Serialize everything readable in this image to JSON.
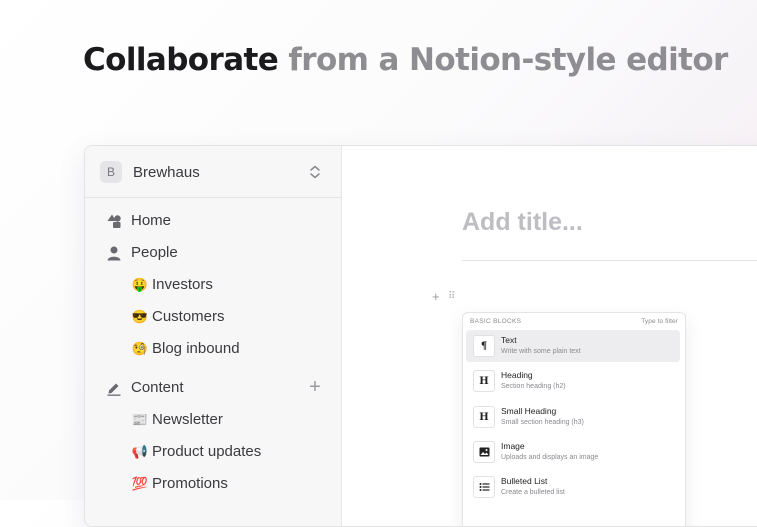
{
  "headline": {
    "strong": "Collaborate",
    "muted": "from a Notion-style editor"
  },
  "workspace": {
    "initial": "B",
    "name": "Brewhaus"
  },
  "sidebar": {
    "items": [
      {
        "label": "Home",
        "icon": "home-icon",
        "level": 0
      },
      {
        "label": "People",
        "icon": "person-icon",
        "level": 0
      },
      {
        "label": "Investors",
        "icon": "🤑",
        "level": 1
      },
      {
        "label": "Customers",
        "icon": "😎",
        "level": 1
      },
      {
        "label": "Blog inbound",
        "icon": "🧐",
        "level": 1
      },
      {
        "label": "Content",
        "icon": "pencil-icon",
        "level": 0,
        "add": "+"
      },
      {
        "label": "Newsletter",
        "icon": "📰",
        "level": 1
      },
      {
        "label": "Product updates",
        "icon": "📢",
        "level": 1
      },
      {
        "label": "Promotions",
        "icon": "💯",
        "level": 1
      }
    ]
  },
  "editor": {
    "title_placeholder": "Add title...",
    "block_add": "+",
    "block_drag": "⠿"
  },
  "block_menu": {
    "section": "BASIC BLOCKS",
    "filter_hint": "Type to filter",
    "items": [
      {
        "icon": "¶",
        "title": "Text",
        "description": "Write with some plain text",
        "active": true
      },
      {
        "icon": "H",
        "title": "Heading",
        "description": "Section heading (h2)"
      },
      {
        "icon": "H",
        "title": "Small Heading",
        "description": "Small section heading (h3)"
      },
      {
        "icon": "image-icon",
        "title": "Image",
        "description": "Uploads and displays an image"
      },
      {
        "icon": "list-icon",
        "title": "Bulleted List",
        "description": "Create a bulleted list"
      }
    ]
  }
}
